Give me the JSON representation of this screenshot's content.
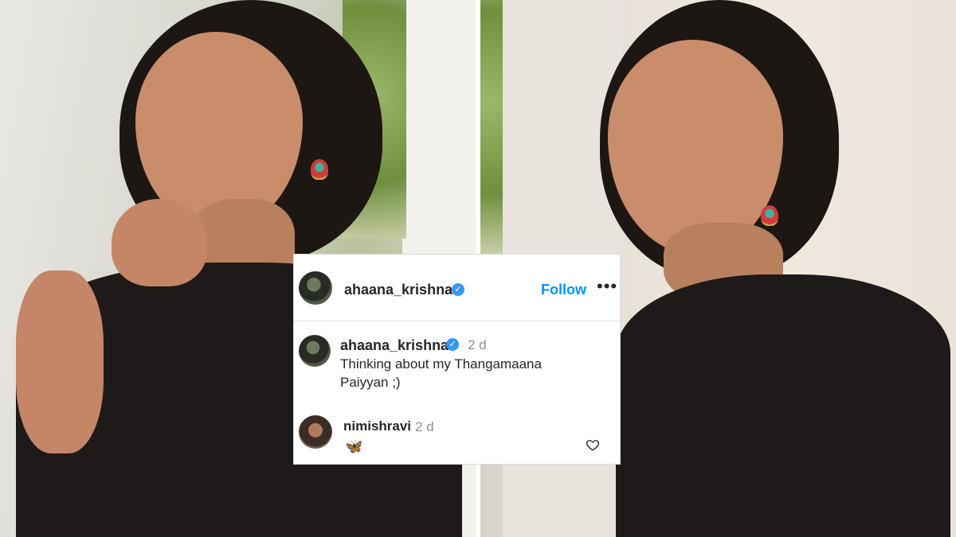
{
  "post": {
    "author": "ahaana_krishna",
    "follow_label": "Follow",
    "more_label": "•••"
  },
  "caption": {
    "author": "ahaana_krishna",
    "time": "2 d",
    "text_line1": "Thinking about my Thangamaana",
    "text_line2": "Paiyyan ;)"
  },
  "reply": {
    "author": "nimishravi",
    "time": "2 d",
    "emoji": "🦋"
  },
  "icons": {
    "verified": "verified-badge-icon",
    "like": "heart-icon",
    "more": "more-options-icon"
  },
  "colors": {
    "follow": "#0095f6",
    "verified": "#3897f0",
    "text": "#262626",
    "muted": "#8e8e8e"
  }
}
